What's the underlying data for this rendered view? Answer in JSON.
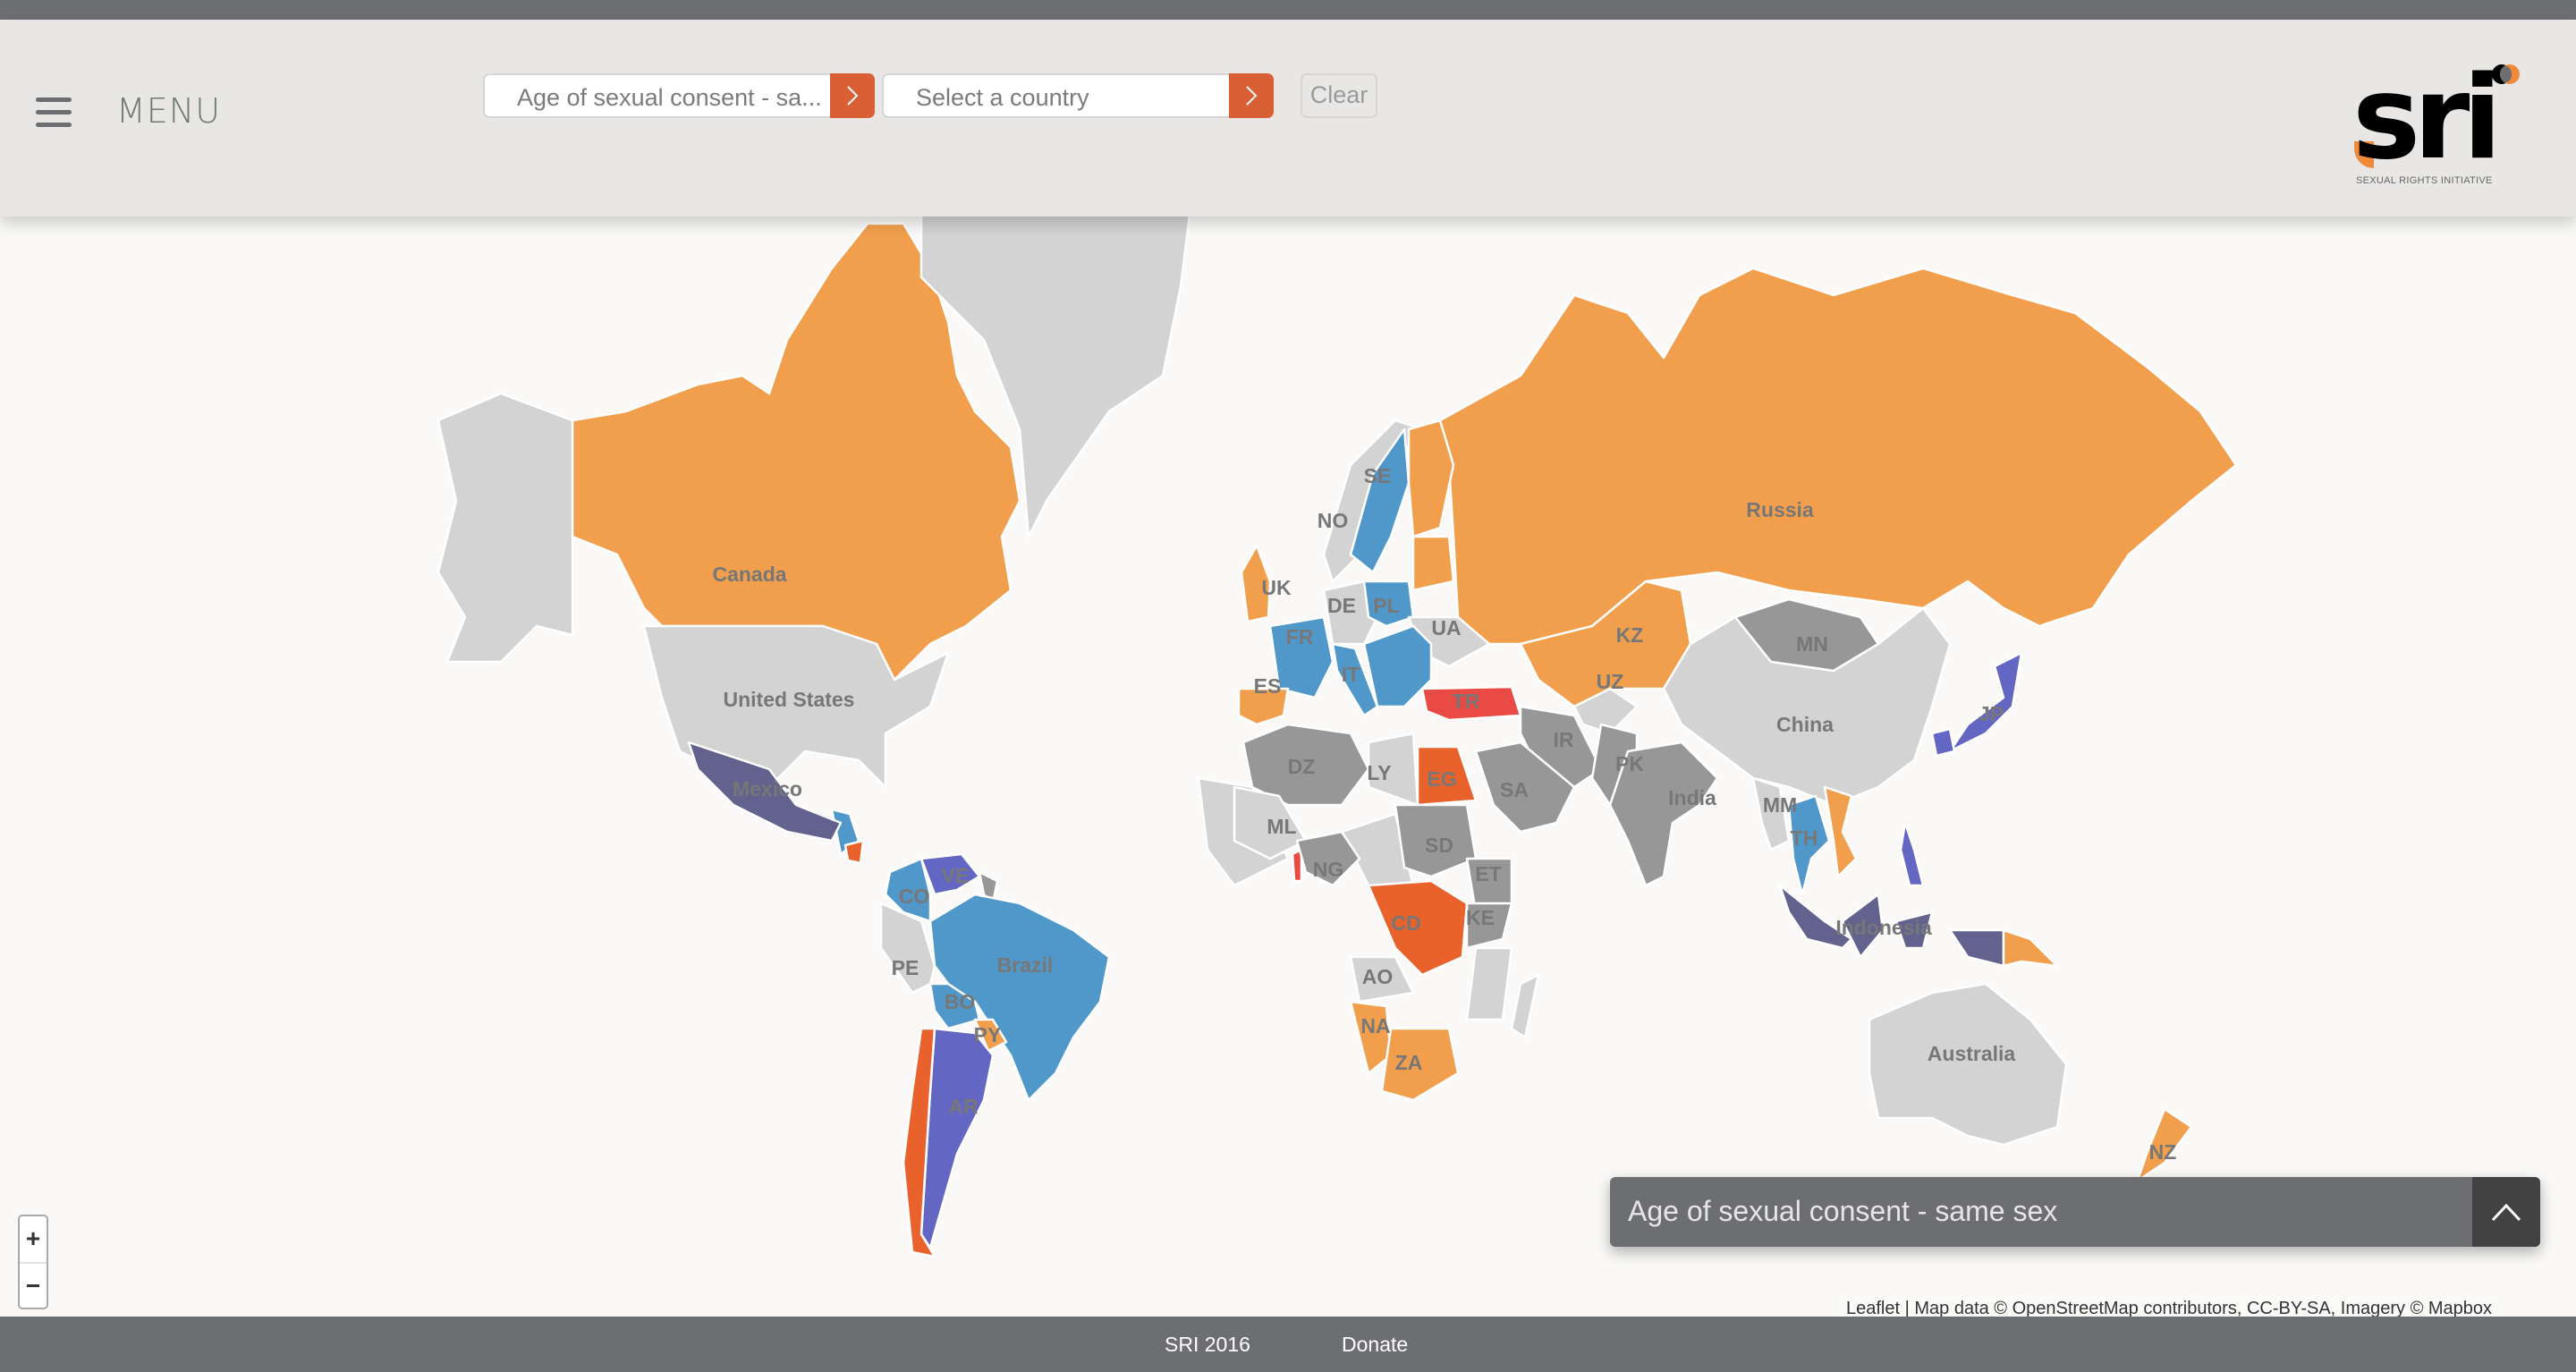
{
  "header": {
    "menu_label": "MENU",
    "topic_select": {
      "value": "Age of sexual consent - sa...",
      "full_value": "Age of sexual consent - same sex"
    },
    "country_select": {
      "placeholder": "Select a country"
    },
    "clear_label": "Clear",
    "logo": {
      "wordmark": "sri",
      "tagline": "SEXUAL RIGHTS INITIATIVE"
    }
  },
  "map": {
    "zoom_in_label": "+",
    "zoom_out_label": "−",
    "legend_title": "Age of sexual consent - same sex",
    "attribution": "Leaflet | Map data © OpenStreetMap contributors, CC-BY-SA, Imagery © Mapbox",
    "category_colors": {
      "orange": "#F19F4D",
      "blue": "#4F98C9",
      "purple": "#6466C4",
      "slate": "#63628F",
      "red_orange": "#E9622B",
      "red": "#E94B44",
      "dark_gray": "#979797",
      "light_gray": "#D3D3D3"
    },
    "countries": [
      {
        "id": "canada",
        "label": "Canada",
        "category": "orange"
      },
      {
        "id": "usa",
        "label": "United States",
        "category": "light_gray"
      },
      {
        "id": "alaska",
        "label": "",
        "category": "light_gray"
      },
      {
        "id": "greenland",
        "label": "",
        "category": "light_gray"
      },
      {
        "id": "mexico",
        "label": "Mexico",
        "category": "slate"
      },
      {
        "id": "russia",
        "label": "Russia",
        "category": "orange"
      },
      {
        "id": "kazakhstan",
        "label": "KZ",
        "category": "orange"
      },
      {
        "id": "mongolia",
        "label": "MN",
        "category": "dark_gray"
      },
      {
        "id": "china",
        "label": "China",
        "category": "light_gray"
      },
      {
        "id": "uzbekistan",
        "label": "UZ",
        "category": "light_gray"
      },
      {
        "id": "iran",
        "label": "IR",
        "category": "dark_gray"
      },
      {
        "id": "pakistan",
        "label": "PK",
        "category": "dark_gray"
      },
      {
        "id": "india",
        "label": "India",
        "category": "dark_gray"
      },
      {
        "id": "myanmar",
        "label": "MM",
        "category": "light_gray"
      },
      {
        "id": "thailand",
        "label": "TH",
        "category": "blue"
      },
      {
        "id": "vietnam",
        "label": "",
        "category": "orange"
      },
      {
        "id": "japan",
        "label": "JP",
        "category": "purple"
      },
      {
        "id": "korea",
        "label": "",
        "category": "purple"
      },
      {
        "id": "philippines",
        "label": "",
        "category": "purple"
      },
      {
        "id": "indonesia",
        "label": "Indonesia",
        "category": "slate"
      },
      {
        "id": "png",
        "label": "",
        "category": "orange"
      },
      {
        "id": "australia",
        "label": "Australia",
        "category": "light_gray"
      },
      {
        "id": "new_zealand",
        "label": "NZ",
        "category": "orange"
      },
      {
        "id": "norway",
        "label": "NO",
        "category": "light_gray"
      },
      {
        "id": "sweden",
        "label": "SE",
        "category": "blue"
      },
      {
        "id": "finland",
        "label": "",
        "category": "orange"
      },
      {
        "id": "uk",
        "label": "UK",
        "category": "orange"
      },
      {
        "id": "germany",
        "label": "DE",
        "category": "light_gray"
      },
      {
        "id": "poland",
        "label": "PL",
        "category": "blue"
      },
      {
        "id": "ukraine",
        "label": "UA",
        "category": "light_gray"
      },
      {
        "id": "france",
        "label": "FR",
        "category": "blue"
      },
      {
        "id": "spain",
        "label": "ES",
        "category": "orange"
      },
      {
        "id": "italy",
        "label": "IT",
        "category": "blue"
      },
      {
        "id": "balkans",
        "label": "",
        "category": "blue"
      },
      {
        "id": "turkey",
        "label": "TR",
        "category": "red"
      },
      {
        "id": "algeria",
        "label": "DZ",
        "category": "dark_gray"
      },
      {
        "id": "libya",
        "label": "LY",
        "category": "light_gray"
      },
      {
        "id": "egypt",
        "label": "EG",
        "category": "red_orange"
      },
      {
        "id": "saudi_arabia",
        "label": "SA",
        "category": "dark_gray"
      },
      {
        "id": "mali",
        "label": "ML",
        "category": "light_gray"
      },
      {
        "id": "nigeria",
        "label": "NG",
        "category": "dark_gray"
      },
      {
        "id": "sudan",
        "label": "SD",
        "category": "dark_gray"
      },
      {
        "id": "ethiopia",
        "label": "ET",
        "category": "dark_gray"
      },
      {
        "id": "kenya",
        "label": "KE",
        "category": "dark_gray"
      },
      {
        "id": "drc",
        "label": "CD",
        "category": "red_orange"
      },
      {
        "id": "angola",
        "label": "AO",
        "category": "light_gray"
      },
      {
        "id": "namibia",
        "label": "NA",
        "category": "orange"
      },
      {
        "id": "south_africa",
        "label": "ZA",
        "category": "orange"
      },
      {
        "id": "colombia",
        "label": "CO",
        "category": "blue"
      },
      {
        "id": "venezuela",
        "label": "VE",
        "category": "purple"
      },
      {
        "id": "peru",
        "label": "PE",
        "category": "light_gray"
      },
      {
        "id": "brazil",
        "label": "Brazil",
        "category": "blue"
      },
      {
        "id": "bolivia",
        "label": "BO",
        "category": "blue"
      },
      {
        "id": "paraguay",
        "label": "PY",
        "category": "orange"
      },
      {
        "id": "argentina",
        "label": "AR",
        "category": "purple"
      },
      {
        "id": "chile",
        "label": "",
        "category": "red_orange"
      }
    ]
  },
  "footer": {
    "links": [
      "SRI 2016",
      "Donate"
    ]
  }
}
